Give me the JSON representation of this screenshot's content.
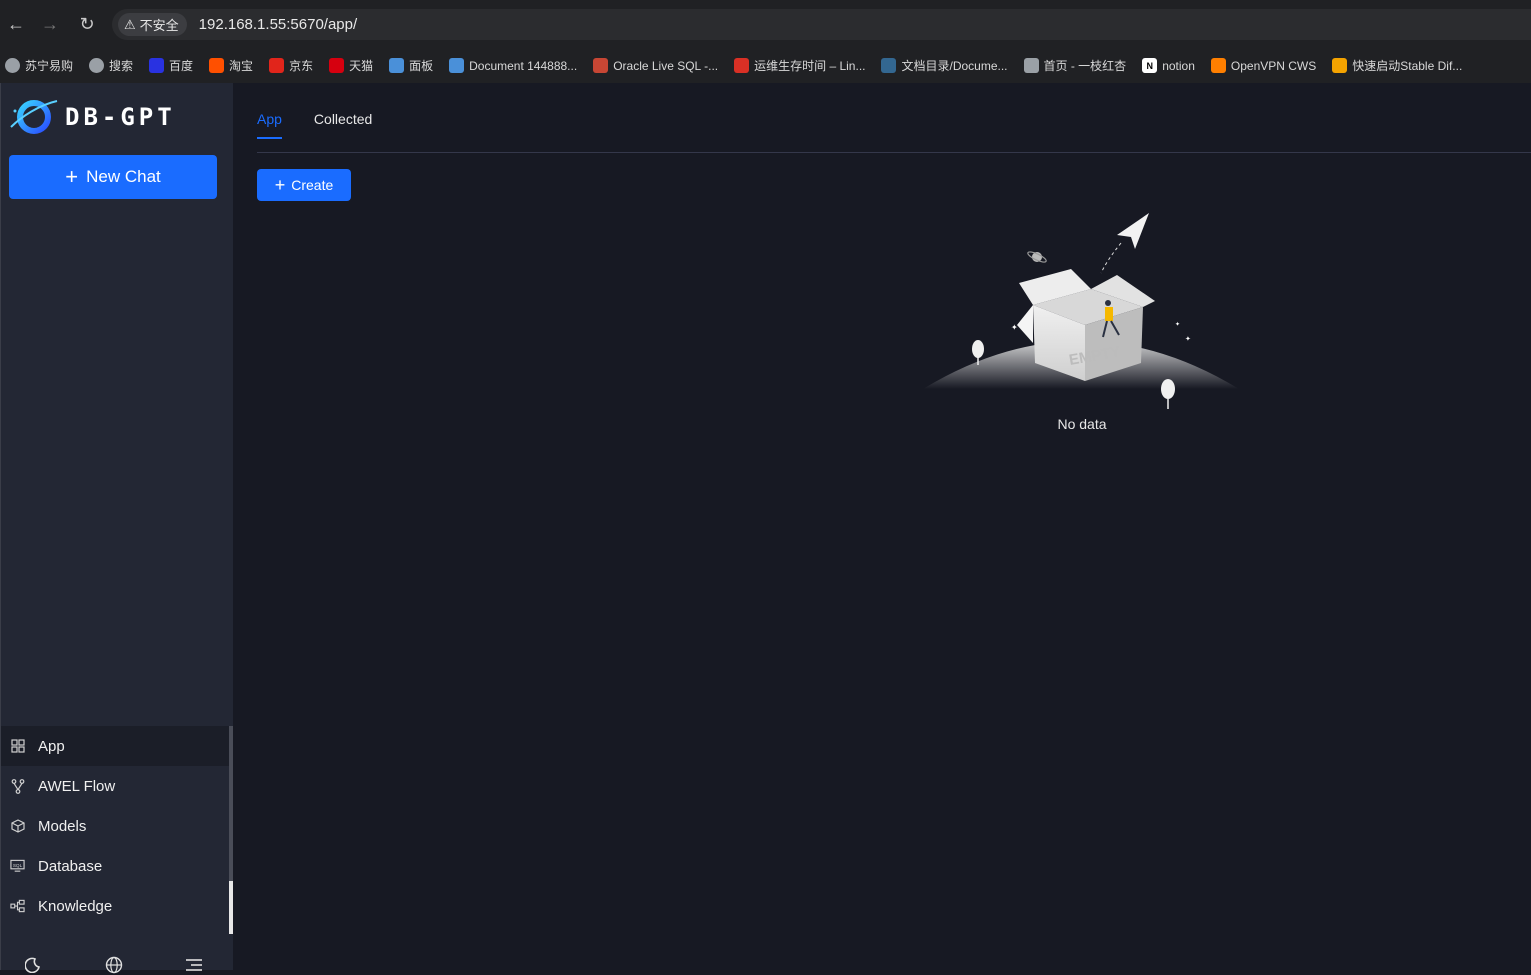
{
  "browser": {
    "security_label": "不安全",
    "url": "192.168.1.55:5670/app/",
    "bookmarks": [
      {
        "label": "苏宁易购",
        "icon": "globe-icon",
        "color": "#9aa0a6"
      },
      {
        "label": "搜索",
        "icon": "globe-icon",
        "color": "#9aa0a6"
      },
      {
        "label": "百度",
        "icon": "baidu-icon",
        "color": "#2932e1"
      },
      {
        "label": "淘宝",
        "icon": "taobao-icon",
        "color": "#ff5000"
      },
      {
        "label": "京东",
        "icon": "jd-icon",
        "color": "#e1251b"
      },
      {
        "label": "天猫",
        "icon": "tmall-icon",
        "color": "#d6000f"
      },
      {
        "label": "面板",
        "icon": "panel-icon",
        "color": "#4a90d9"
      },
      {
        "label": "Document 144888...",
        "icon": "document-icon",
        "color": "#4a90d9"
      },
      {
        "label": "Oracle Live SQL -...",
        "icon": "oracle-icon",
        "color": "#c74634"
      },
      {
        "label": "运维生存时间 – Lin...",
        "icon": "shield-icon",
        "color": "#d93025"
      },
      {
        "label": "文档目录/Docume...",
        "icon": "postgres-icon",
        "color": "#336791"
      },
      {
        "label": "首页 - 一枝红杏",
        "icon": "paper-plane-icon",
        "color": "#9aa0a6"
      },
      {
        "label": "notion",
        "icon": "notion-icon",
        "color": "#ffffff"
      },
      {
        "label": "OpenVPN CWS",
        "icon": "openvpn-icon",
        "color": "#ff7f00"
      },
      {
        "label": "快速启动Stable Dif...",
        "icon": "link-icon",
        "color": "#f4a300"
      }
    ]
  },
  "sidebar": {
    "logo_text": "DB-GPT",
    "new_chat_label": "New Chat",
    "menu": [
      {
        "label": "App",
        "icon": "grid-icon",
        "active": true
      },
      {
        "label": "AWEL Flow",
        "icon": "flow-icon",
        "active": false
      },
      {
        "label": "Models",
        "icon": "cube-icon",
        "active": false
      },
      {
        "label": "Database",
        "icon": "database-icon",
        "active": false
      },
      {
        "label": "Knowledge",
        "icon": "knowledge-icon",
        "active": false
      }
    ]
  },
  "main": {
    "tabs": [
      {
        "label": "App",
        "active": true
      },
      {
        "label": "Collected",
        "active": false
      }
    ],
    "create_label": "Create",
    "empty_text": "No data",
    "empty_illustration_text": "EMPTY"
  },
  "colors": {
    "accent": "#1a6cff",
    "sidebar_bg": "#232734",
    "main_bg": "#171923"
  }
}
